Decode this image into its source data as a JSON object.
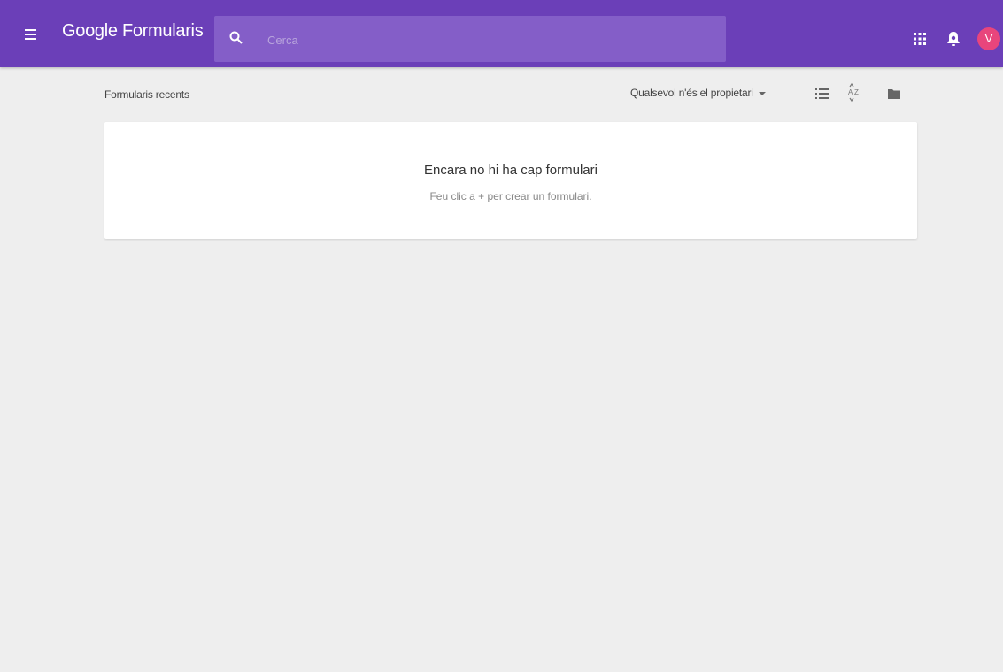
{
  "colors": {
    "appbar": "#6b3fb8",
    "search_bg": "#845ec8",
    "avatar": "#e8457c",
    "background": "#eeeeee"
  },
  "header": {
    "menu_icon": "hamburger-menu-icon",
    "logo": "Google Formularis",
    "search": {
      "icon": "search-icon",
      "placeholder": "Cerca"
    },
    "apps_icon": "apps-grid-icon",
    "notifications_icon": "notifications-icon",
    "avatar_initial": "V"
  },
  "toolbar": {
    "title": "Formularis recents",
    "owner_filter": "Qualsevol n'és el propietari",
    "list_view_icon": "list-view-icon",
    "sort_icon": "sort-az-icon",
    "folder_icon": "folder-icon"
  },
  "empty_state": {
    "title": "Encara no hi ha cap formulari",
    "hint": "Feu clic a + per crear un formulari."
  }
}
